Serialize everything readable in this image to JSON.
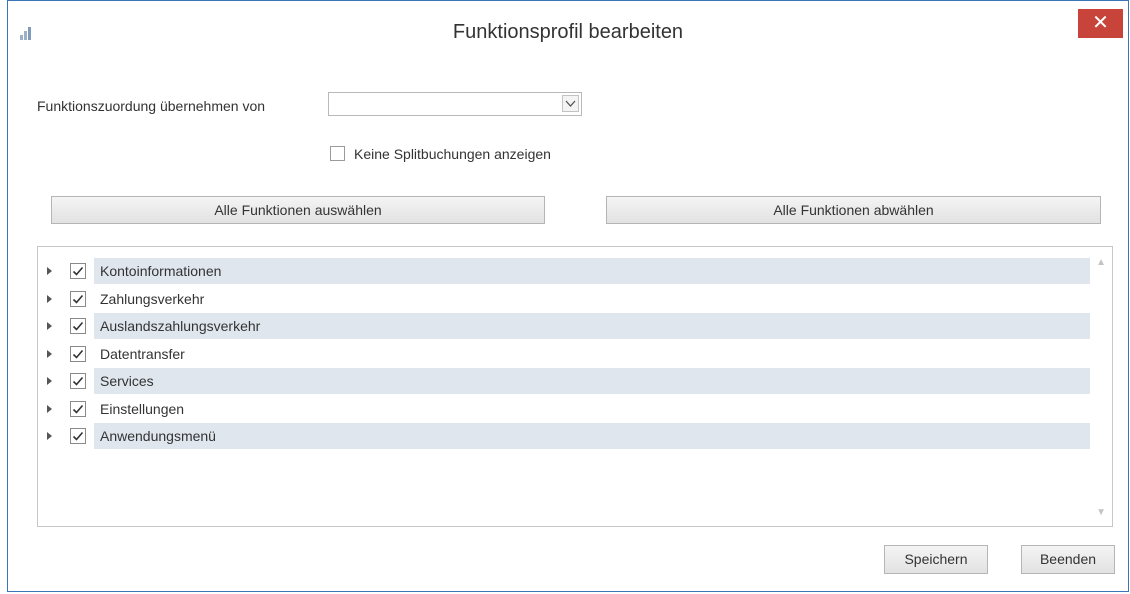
{
  "window": {
    "title": "Funktionsprofil bearbeiten",
    "close_label": "✕"
  },
  "form": {
    "copy_from_label": "Funktionszuordung übernehmen von",
    "copy_from_value": "",
    "no_split_label": "Keine Splitbuchungen anzeigen",
    "no_split_checked": false
  },
  "buttons": {
    "select_all": "Alle Funktionen auswählen",
    "deselect_all": "Alle Funktionen abwählen",
    "save": "Speichern",
    "close": "Beenden"
  },
  "tree": {
    "items": [
      {
        "label": "Kontoinformationen",
        "checked": true
      },
      {
        "label": "Zahlungsverkehr",
        "checked": true
      },
      {
        "label": "Auslandszahlungsverkehr",
        "checked": true
      },
      {
        "label": "Datentransfer",
        "checked": true
      },
      {
        "label": "Services",
        "checked": true
      },
      {
        "label": "Einstellungen",
        "checked": true
      },
      {
        "label": "Anwendungsmenü",
        "checked": true
      }
    ]
  }
}
